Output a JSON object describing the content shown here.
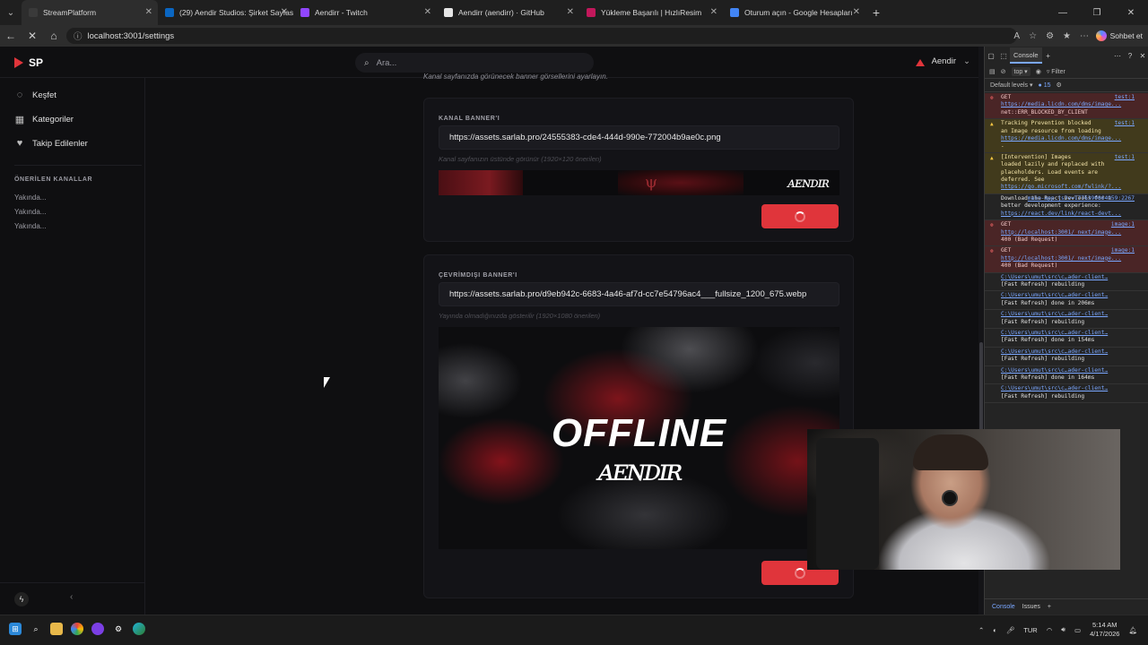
{
  "browser": {
    "tabs": [
      {
        "title": "StreamPlatform",
        "active": true,
        "color": "#3a3a3a"
      },
      {
        "title": "(29) Aendir Studios: Şirket Sayfası",
        "active": false,
        "color": "#0a66c2"
      },
      {
        "title": "Aendirr - Twitch",
        "active": false,
        "color": "#9146ff"
      },
      {
        "title": "Aendirr (aendirr) · GitHub",
        "active": false,
        "color": "#e6e6e6"
      },
      {
        "title": "Yükleme Başarılı | HızlıResim",
        "active": false,
        "color": "#c2185b"
      },
      {
        "title": "Oturum açın - Google Hesapları",
        "active": false,
        "color": "#4285f4"
      }
    ],
    "url": "localhost:3001/settings",
    "copilot_label": "Sohbet et"
  },
  "app": {
    "logo": "SP",
    "search_placeholder": "Ara...",
    "username": "Aendir",
    "accent": "#e0353b",
    "nav": [
      {
        "label": "Keşfet",
        "icon": "compass-icon"
      },
      {
        "label": "Kategoriler",
        "icon": "grid-icon"
      },
      {
        "label": "Takip Edilenler",
        "icon": "heart-icon"
      }
    ],
    "recommended_heading": "ÖNERİLEN KANALLAR",
    "recommended": [
      "Yakında...",
      "Yakında...",
      "Yakında..."
    ],
    "cut_text": "Kanal sayfanızda görünecek banner görsellerini ayarlayın.",
    "channel_banner": {
      "label": "KANAL BANNER'I",
      "value": "https://assets.sarlab.pro/24555383-cde4-444d-990e-772004b9ae0c.png",
      "hint": "Kanal sayfanızın üstünde görünür (1920×120 önerilen)"
    },
    "offline_banner": {
      "label": "ÇEVRİMDIŞI BANNER'I",
      "value": "https://assets.sarlab.pro/d9eb942c-6683-4a46-af7d-cc7e54796ac4___fullsize_1200_675.webp",
      "hint": "Yayında olmadığınızda gösterilir (1920×1080 önerilen)",
      "image_text": "OFFLINE"
    }
  },
  "devtools": {
    "tab": "Console",
    "context": "top",
    "filter_placeholder": "Filter",
    "levels": "Default levels",
    "count": "15",
    "logs": [
      {
        "type": "err",
        "src": "test:1",
        "lines": [
          "GET",
          "https://media.licdn.com/dms/image...",
          "net::ERR_BLOCKED_BY_CLIENT"
        ]
      },
      {
        "type": "warn",
        "src": "test:1",
        "lines": [
          "Tracking Prevention blocked",
          "an Image resource from loading",
          "https://media.licdn.com/dms/image...",
          "."
        ]
      },
      {
        "type": "warn",
        "src": "test:1",
        "lines": [
          "[Intervention] Images",
          "loaded lazily and replaced with",
          "placeholders. Load events are",
          "deferred. See",
          "https://go.microsoft.com/fwlink/?..."
        ]
      },
      {
        "type": "info",
        "src": "main-app.js?v=1776390864959:2267",
        "lines": [
          "Download the React DevTools for a",
          "better development experience:",
          "https://react.dev/link/react-devt..."
        ]
      },
      {
        "type": "err",
        "src": "image:1",
        "lines": [
          "GET",
          "http://localhost:3001/_next/image...",
          "400 (Bad Request)"
        ]
      },
      {
        "type": "err",
        "src": "image:1",
        "lines": [
          "GET",
          "http://localhost:3001/_next/image...",
          "400 (Bad Request)"
        ]
      },
      {
        "type": "info",
        "src": "",
        "lines": [
          "C:\\Users\\umut\\src\\c…ader-client…",
          "[Fast Refresh] rebuilding"
        ]
      },
      {
        "type": "info",
        "src": "",
        "lines": [
          "C:\\Users\\umut\\src\\c…ader-client…",
          "[Fast Refresh] done in 206ms"
        ]
      },
      {
        "type": "info",
        "src": "",
        "lines": [
          "C:\\Users\\umut\\src\\c…ader-client…",
          "[Fast Refresh] rebuilding"
        ]
      },
      {
        "type": "info",
        "src": "",
        "lines": [
          "C:\\Users\\umut\\src\\c…ader-client…",
          "[Fast Refresh] done in 154ms"
        ]
      },
      {
        "type": "info",
        "src": "",
        "lines": [
          "C:\\Users\\umut\\src\\c…ader-client…",
          "[Fast Refresh] rebuilding"
        ]
      },
      {
        "type": "info",
        "src": "",
        "lines": [
          "C:\\Users\\umut\\src\\c…ader-client…",
          "[Fast Refresh] done in 164ms"
        ]
      },
      {
        "type": "info",
        "src": "",
        "lines": [
          "C:\\Users\\umut\\src\\c…ader-client…",
          "[Fast Refresh] rebuilding"
        ]
      }
    ],
    "bottom_tabs": [
      "Console",
      "Issues"
    ]
  },
  "taskbar": {
    "lang": "TUR",
    "time": "5:14 AM",
    "date": "4/17/2026"
  }
}
